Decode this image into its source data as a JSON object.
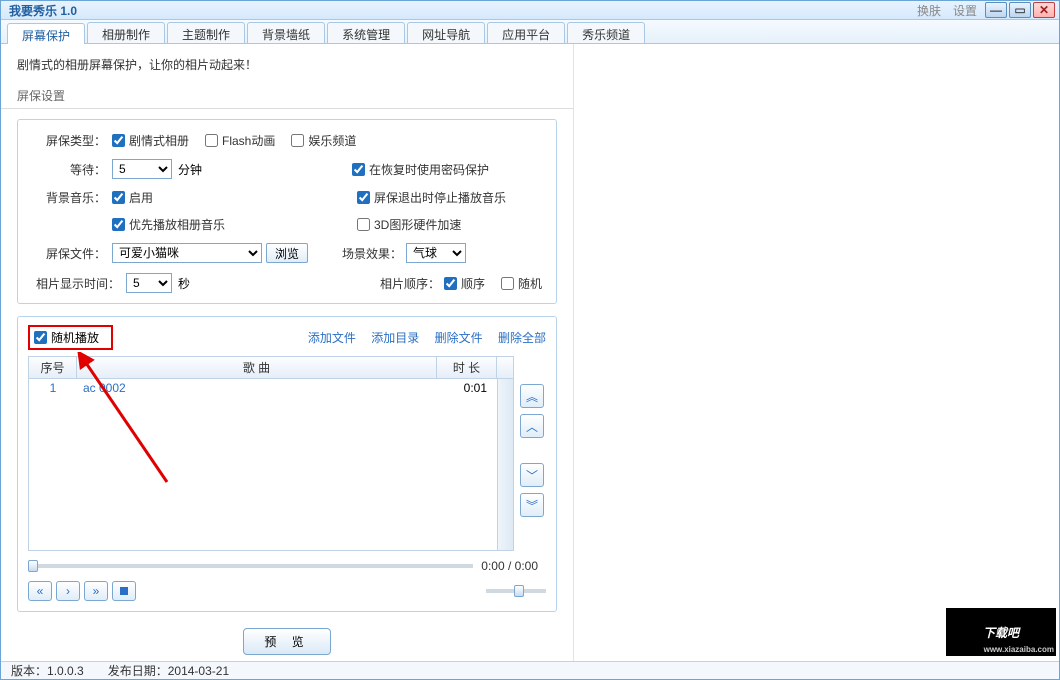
{
  "window": {
    "title": "我要秀乐 1.0",
    "links": {
      "skin": "换肤",
      "settings": "设置"
    }
  },
  "tabs": [
    "屏幕保护",
    "相册制作",
    "主题制作",
    "背景墙纸",
    "系统管理",
    "网址导航",
    "应用平台",
    "秀乐频道"
  ],
  "intro": "剧情式的相册屏幕保护，让你的相片动起来！",
  "section_title": "屏保设置",
  "settings": {
    "type_label": "屏保类型：",
    "types": {
      "drama": "剧情式相册",
      "flash": "Flash动画",
      "entertain": "娱乐频道"
    },
    "wait_label": "等待：",
    "wait_value": "5",
    "wait_unit": "分钟",
    "pw_protect": "在恢复时使用密码保护",
    "bgm_label": "背景音乐：",
    "bgm_enable": "启用",
    "bgm_stop": "屏保退出时停止播放音乐",
    "bgm_prior": "优先播放相册音乐",
    "hw3d": "3D图形硬件加速",
    "file_label": "屏保文件：",
    "file_value": "可爱小猫咪",
    "browse": "浏览",
    "scene_label": "场景效果：",
    "scene_value": "气球",
    "photo_time_label": "相片显示时间：",
    "photo_time_value": "5",
    "photo_time_unit": "秒",
    "order_label": "相片顺序：",
    "order_seq": "顺序",
    "order_rand": "随机"
  },
  "playlist": {
    "random": "随机播放",
    "links": {
      "add_file": "添加文件",
      "add_dir": "添加目录",
      "del_file": "删除文件",
      "del_all": "删除全部"
    },
    "cols": {
      "num": "序号",
      "song": "歌 曲",
      "dur": "时 长"
    },
    "rows": [
      {
        "num": "1",
        "song": "ac 0002",
        "dur": "0:01"
      }
    ],
    "time": "0:00 / 0:00"
  },
  "preview": "预 览",
  "status": {
    "version_label": "版本：",
    "version": "1.0.0.3",
    "date_label": "发布日期：",
    "date": "2014-03-21"
  },
  "watermark": {
    "main": "下载吧",
    "sub": "www.xiazaiba.com"
  }
}
